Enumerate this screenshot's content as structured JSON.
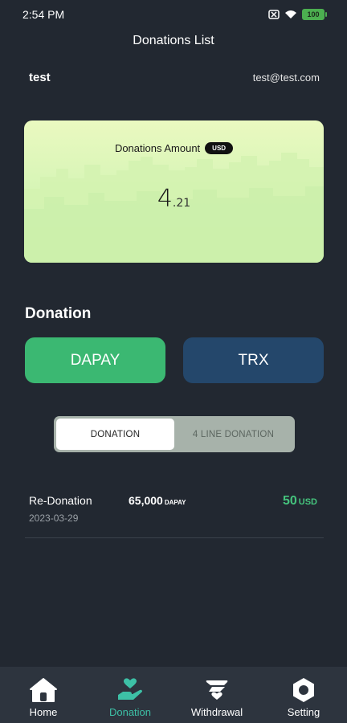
{
  "status_bar": {
    "time": "2:54 PM",
    "battery": "100"
  },
  "header": {
    "title": "Donations List"
  },
  "user": {
    "name": "test",
    "email": "test@test.com"
  },
  "amount_card": {
    "label": "Donations Amount",
    "currency": "USD",
    "value_int": "4",
    "value_dec": ".21"
  },
  "donation": {
    "section_title": "Donation",
    "buttons": [
      "DAPAY",
      "TRX"
    ]
  },
  "segment": {
    "tabs": [
      "DONATION",
      "4 LINE DONATION"
    ],
    "active_index": 0
  },
  "transactions": [
    {
      "type": "Re-Donation",
      "date": "2023-03-29",
      "amount": "65,000",
      "amount_unit": "DAPAY",
      "usd": "50",
      "usd_unit": "USD"
    }
  ],
  "bottom_nav": {
    "items": [
      {
        "label": "Home",
        "icon": "home-icon"
      },
      {
        "label": "Donation",
        "icon": "hand-heart-icon"
      },
      {
        "label": "Withdrawal",
        "icon": "withdrawal-icon"
      },
      {
        "label": "Setting",
        "icon": "gear-icon"
      }
    ],
    "active_index": 1
  },
  "colors": {
    "background": "#222831",
    "accent_green": "#3bb872",
    "trx_blue": "#24476b",
    "nav_active": "#3dc0a6"
  }
}
